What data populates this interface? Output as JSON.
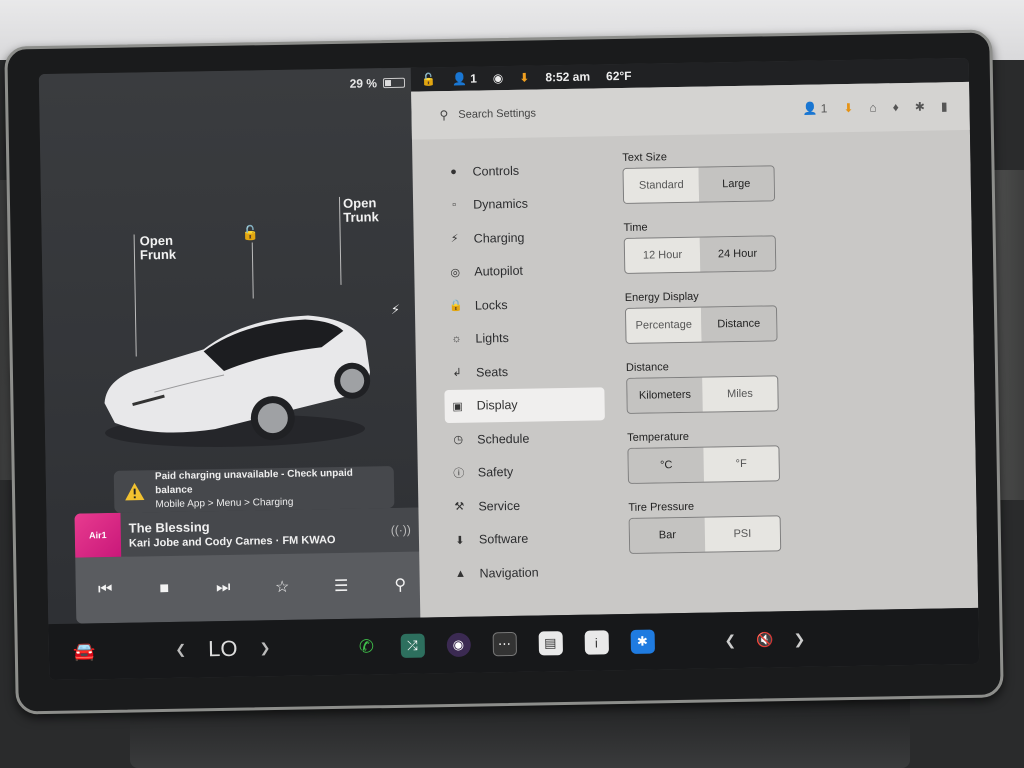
{
  "status": {
    "battery_pct": "29 %",
    "battery_level": 0.29,
    "profile_count": "1",
    "time": "8:52 am",
    "temp": "62°F"
  },
  "car_panel": {
    "open_frunk_line1": "Open",
    "open_frunk_line2": "Frunk",
    "open_trunk_line1": "Open",
    "open_trunk_line2": "Trunk"
  },
  "alert": {
    "title": "Paid charging unavailable - Check unpaid balance",
    "path": "Mobile App > Menu > Charging"
  },
  "media": {
    "art_text": "Air1",
    "title": "The Blessing",
    "artist": "Kari Jobe and Cody Carnes · FM KWAO"
  },
  "settings": {
    "search_placeholder": "Search Settings",
    "top_profile_count": "1",
    "menu": [
      {
        "label": "Controls",
        "icon": "toggle-icon"
      },
      {
        "label": "Dynamics",
        "icon": "car-icon"
      },
      {
        "label": "Charging",
        "icon": "bolt-icon"
      },
      {
        "label": "Autopilot",
        "icon": "steering-wheel-icon"
      },
      {
        "label": "Locks",
        "icon": "lock-icon"
      },
      {
        "label": "Lights",
        "icon": "sun-icon"
      },
      {
        "label": "Seats",
        "icon": "seat-icon"
      },
      {
        "label": "Display",
        "icon": "display-icon"
      },
      {
        "label": "Schedule",
        "icon": "clock-icon"
      },
      {
        "label": "Safety",
        "icon": "info-circle-icon"
      },
      {
        "label": "Service",
        "icon": "wrench-icon"
      },
      {
        "label": "Software",
        "icon": "download-icon"
      },
      {
        "label": "Navigation",
        "icon": "navigation-icon"
      }
    ],
    "active_item": "Display",
    "options": {
      "text_size": {
        "label": "Text Size",
        "a": "Standard",
        "b": "Large",
        "selected": "a"
      },
      "time": {
        "label": "Time",
        "a": "12 Hour",
        "b": "24 Hour",
        "selected": "a"
      },
      "energy": {
        "label": "Energy Display",
        "a": "Percentage",
        "b": "Distance",
        "selected": "a"
      },
      "distance": {
        "label": "Distance",
        "a": "Kilometers",
        "b": "Miles",
        "selected": "b"
      },
      "temperature": {
        "label": "Temperature",
        "a": "°C",
        "b": "°F",
        "selected": "b"
      },
      "tire": {
        "label": "Tire Pressure",
        "a": "Bar",
        "b": "PSI",
        "selected": "b"
      }
    }
  },
  "dock": {
    "temp_setting": "LO"
  },
  "colors": {
    "accent_orange": "#e59317",
    "media_art": "#e0308a",
    "phone_green": "#3fbf4a",
    "bluetooth_blue": "#1f7be0"
  }
}
